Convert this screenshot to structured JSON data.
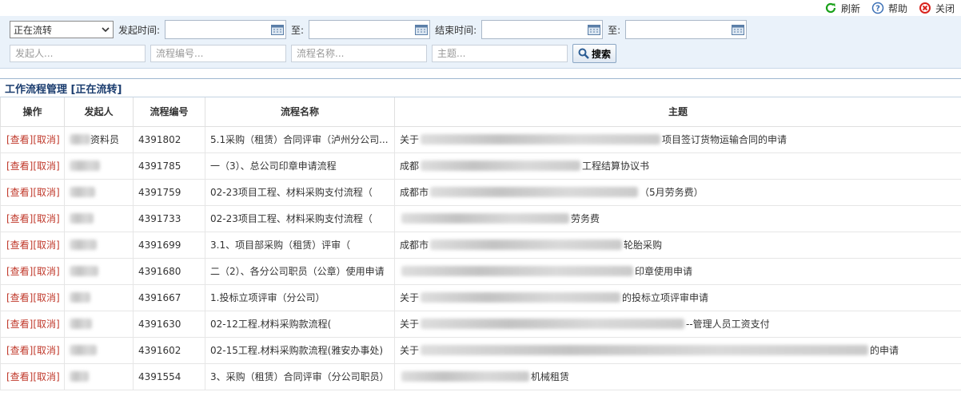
{
  "toolbar": {
    "refresh_label": "刷新",
    "help_label": "帮助",
    "close_label": "关闭"
  },
  "filter": {
    "status_selected": "正在流转",
    "start_time_label": "发起时间:",
    "to_label": "至:",
    "end_time_label": "结束时间:",
    "initiator_placeholder": "发起人...",
    "flow_no_placeholder": "流程编号...",
    "flow_name_placeholder": "流程名称...",
    "subject_placeholder": "主题...",
    "search_label": "搜索"
  },
  "panel": {
    "title": "工作流程管理 [正在流转]"
  },
  "table": {
    "headers": {
      "ops": "操作",
      "initiator": "发起人",
      "flow_no": "流程编号",
      "flow_name": "流程名称",
      "subject": "主题"
    },
    "view_label": "[查看]",
    "cancel_label": "[取消]",
    "rows": [
      {
        "initiator": "资料员",
        "flow_no": "4391802",
        "flow_name": "5.1采购（租赁）合同评审（泸州分公司...",
        "subject_prefix": "关于",
        "subject_suffix": "项目签订货物运输合同的申请"
      },
      {
        "initiator": "",
        "flow_no": "4391785",
        "flow_name": "一（3）、总公司印章申请流程",
        "subject_prefix": "成都",
        "subject_suffix": "工程结算协议书"
      },
      {
        "initiator": "",
        "flow_no": "4391759",
        "flow_name": "02-23项目工程、材料采购支付流程（",
        "subject_prefix": "成都市",
        "subject_suffix": "（5月劳务费）"
      },
      {
        "initiator": "",
        "flow_no": "4391733",
        "flow_name": "02-23项目工程、材料采购支付流程（",
        "subject_prefix": "",
        "subject_suffix": "劳务费"
      },
      {
        "initiator": "",
        "flow_no": "4391699",
        "flow_name": "3.1、项目部采购（租赁）评审（",
        "subject_prefix": "成都市",
        "subject_suffix": "轮胎采购"
      },
      {
        "initiator": "",
        "flow_no": "4391680",
        "flow_name": "二（2）、各分公司职员（公章）使用申请",
        "subject_prefix": "",
        "subject_suffix": "印章使用申请"
      },
      {
        "initiator": "",
        "flow_no": "4391667",
        "flow_name": "1.投标立项评审（分公司）",
        "subject_prefix": "关于",
        "subject_suffix": "的投标立项评审申请"
      },
      {
        "initiator": "",
        "flow_no": "4391630",
        "flow_name": "02-12工程.材料采购款流程(",
        "subject_prefix": "关于",
        "subject_suffix": "--管理人员工资支付"
      },
      {
        "initiator": "",
        "flow_no": "4391602",
        "flow_name": "02-15工程.材料采购款流程(雅安办事处)",
        "subject_prefix": "关于",
        "subject_suffix": "的申请"
      },
      {
        "initiator": "",
        "flow_no": "4391554",
        "flow_name": "3、采购（租赁）合同评审（分公司职员）",
        "subject_prefix": "",
        "subject_suffix": "机械租赁"
      }
    ]
  },
  "colors": {
    "filter_bg": "#eaf2fa",
    "link_red": "#c0392b",
    "title_blue": "#1a3c6e",
    "refresh_green": "#1aa11a",
    "close_red": "#d9231d",
    "help_blue": "#3a6fb5"
  }
}
